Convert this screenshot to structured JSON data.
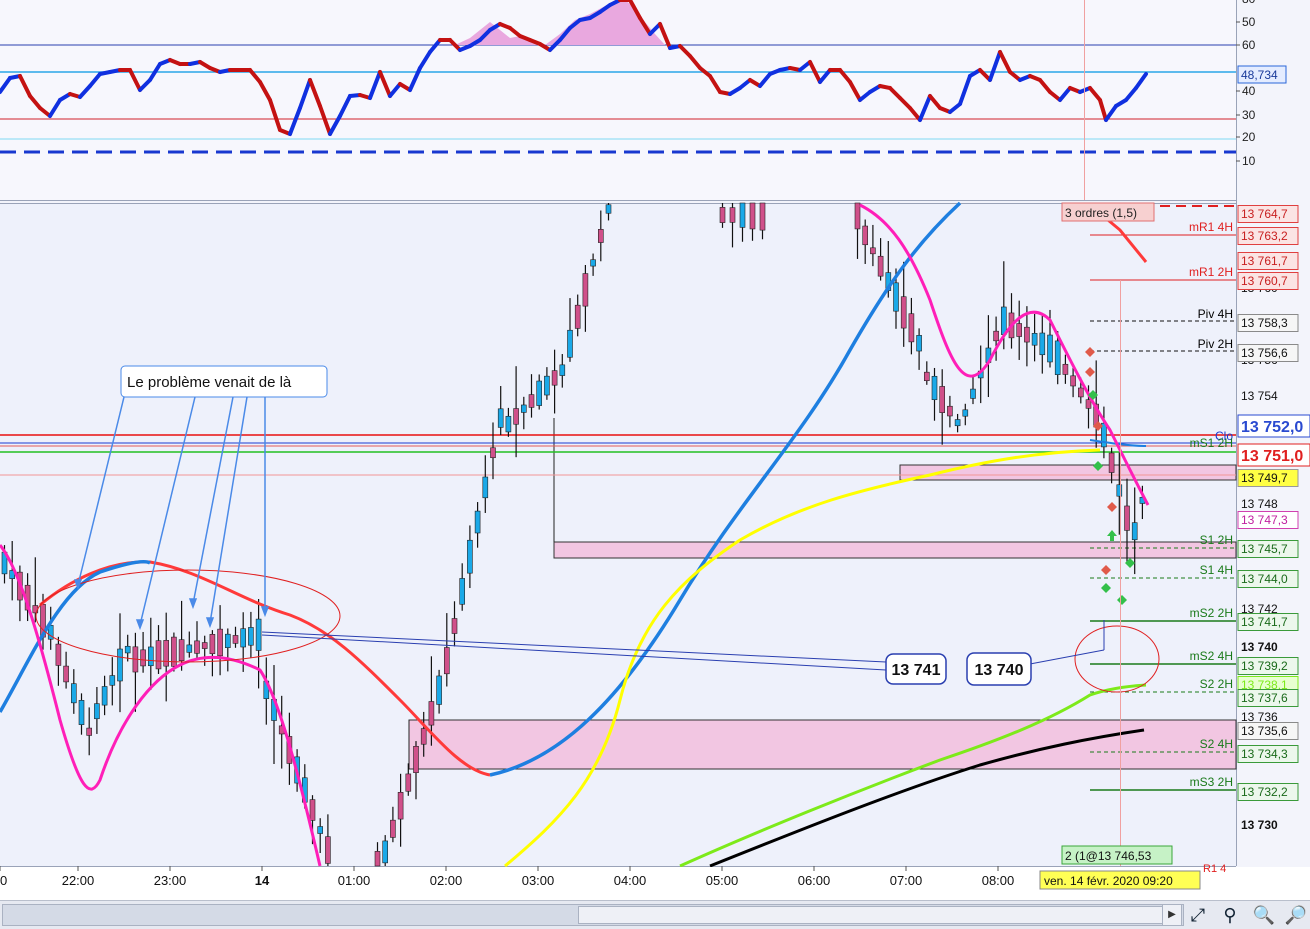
{
  "rsi": {
    "ticks": [
      "80",
      "60",
      "50",
      "40",
      "30",
      "20",
      "10"
    ],
    "value_label": "48,734"
  },
  "price_axis": {
    "ticks": [
      "13 760",
      "13 756",
      "13 754",
      "13 748",
      "13 742",
      "13 740",
      "13 736",
      "13 730"
    ],
    "labels": [
      {
        "text": "13 764,7",
        "kind": "red"
      },
      {
        "text": "13 763,2",
        "kind": "red"
      },
      {
        "text": "13 761,7",
        "kind": "red"
      },
      {
        "text": "13 760,7",
        "kind": "red"
      },
      {
        "text": "13 758,3",
        "kind": "plain"
      },
      {
        "text": "13 756,6",
        "kind": "plain"
      },
      {
        "text": "13 752,0",
        "kind": "blue-big"
      },
      {
        "text": "13 751,0",
        "kind": "red-big"
      },
      {
        "text": "13 749,7",
        "kind": "yellow"
      },
      {
        "text": "13 747,3",
        "kind": "magenta"
      },
      {
        "text": "13 745,7",
        "kind": "green"
      },
      {
        "text": "13 744,0",
        "kind": "green"
      },
      {
        "text": "13 741,7",
        "kind": "green"
      },
      {
        "text": "13 739,2",
        "kind": "green"
      },
      {
        "text": "13 738,1",
        "kind": "lime"
      },
      {
        "text": "13 737,6",
        "kind": "green"
      },
      {
        "text": "13 735,6",
        "kind": "plain"
      },
      {
        "text": "13 734,3",
        "kind": "green"
      },
      {
        "text": "13 732,2",
        "kind": "green"
      }
    ]
  },
  "levels": [
    {
      "label": "mR1 4H",
      "color": "#e02020"
    },
    {
      "label": "mR1 2H",
      "color": "#e02020"
    },
    {
      "label": "Piv 4H",
      "color": "#000000"
    },
    {
      "label": "Piv 2H",
      "color": "#000000"
    },
    {
      "label": "S1 2H",
      "color": "#1a7a1a"
    },
    {
      "label": "S1 4H",
      "color": "#1a7a1a"
    },
    {
      "label": "mS2 2H",
      "color": "#1a7a1a"
    },
    {
      "label": "mS2 4H",
      "color": "#1a7a1a"
    },
    {
      "label": "S2 2H",
      "color": "#1a7a1a"
    },
    {
      "label": "S2 4H",
      "color": "#1a7a1a"
    },
    {
      "label": "mS3 2H",
      "color": "#1a7a1a"
    }
  ],
  "annotations": {
    "callout": "Le problème venait de là",
    "box1": "13 741",
    "box2": "13 740",
    "orders": "3 ordres (1,5)",
    "position": "2 (1@13 746,53",
    "clo": "Clo",
    "ms1": "mS1 2H"
  },
  "time_axis": {
    "labels": [
      "0",
      "22:00",
      "23:00",
      "14",
      "01:00",
      "02:00",
      "03:00",
      "04:00",
      "05:00",
      "06:00",
      "07:00",
      "08:00"
    ],
    "cursor_label": "ven. 14 févr. 2020 09:20",
    "partial_label": "R1 4"
  },
  "toolbar": {
    "icons": [
      "auto-scale-icon",
      "zoom-fit-icon",
      "zoom-out-icon",
      "zoom-in-icon"
    ]
  },
  "colors": {
    "bull_candle": "#1aa9e8",
    "bear_candle": "#d0508a",
    "ema_fast": "#ff1fb8",
    "ema_blue": "#1e7fe0",
    "ma_yellow": "#ffff00",
    "ma_green": "#7dea1a",
    "ma_black": "#000000",
    "ma_red": "#ff3a3a",
    "zone_fill": "#f2c6e2"
  },
  "chart_data": {
    "type": "candlestick",
    "instrument_note": "",
    "rsi_pane": {
      "ylim": [
        0,
        85
      ],
      "guide_levels": [
        61,
        48.734,
        30,
        21,
        16
      ],
      "current": 48.734
    },
    "price_pane": {
      "ylim": [
        13728,
        13765
      ]
    },
    "x_range": [
      "21:00",
      "09:25"
    ],
    "cursor_time": "ven. 14 févr. 2020 09:20"
  }
}
